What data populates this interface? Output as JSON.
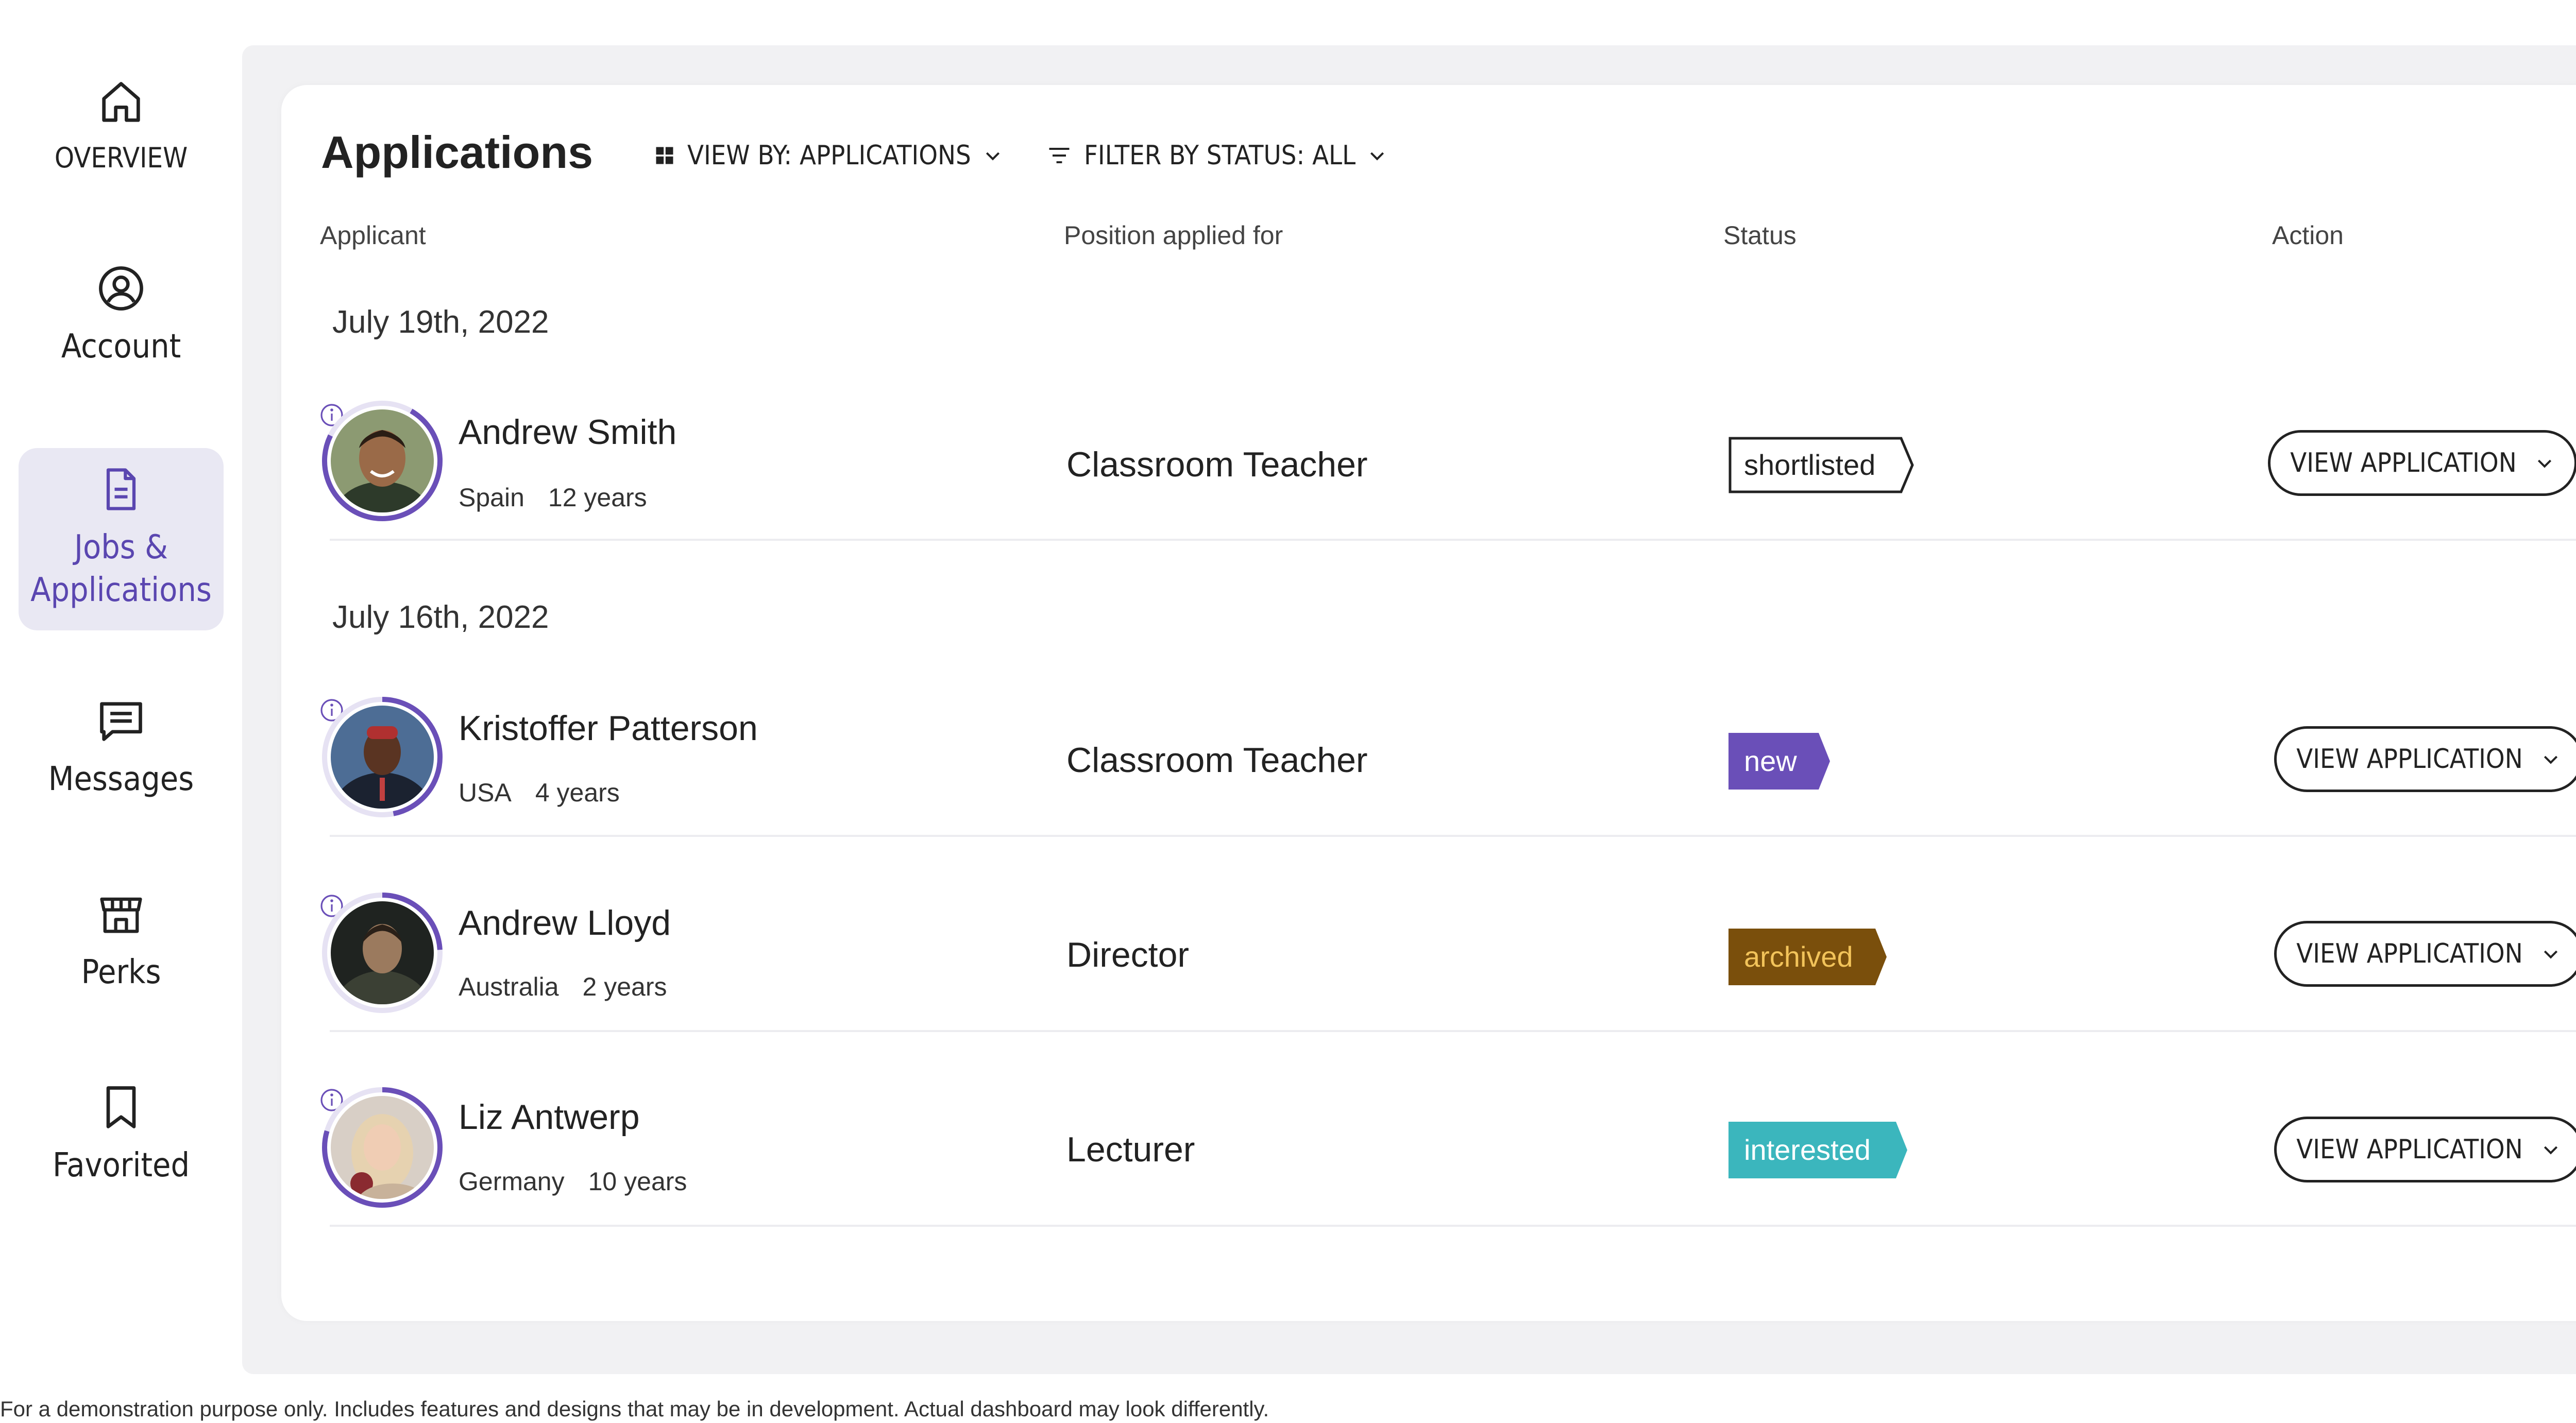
{
  "sidebar": {
    "items": [
      {
        "label": "OVERVIEW",
        "icon": "home-icon"
      },
      {
        "label": "Account",
        "icon": "user-circle-icon"
      },
      {
        "label": "Jobs &",
        "label2": "Applications",
        "icon": "document-icon",
        "active": true
      },
      {
        "label": "Messages",
        "icon": "message-icon"
      },
      {
        "label": "Perks",
        "icon": "storefront-icon"
      },
      {
        "label": "Favorited",
        "icon": "bookmark-icon"
      }
    ]
  },
  "header": {
    "title": "Applications",
    "view_by_label": "VIEW BY: APPLICATIONS",
    "filter_label": "FILTER BY STATUS: ALL"
  },
  "columns": {
    "applicant": "Applicant",
    "position": "Position applied for",
    "status": "Status",
    "action": "Action"
  },
  "groups": [
    {
      "date": "July 19th, 2022"
    },
    {
      "date": "July 16th, 2022"
    }
  ],
  "applications": [
    {
      "name": "Andrew Smith",
      "country": "Spain",
      "experience": "12 years",
      "position": "Classroom Teacher",
      "status": "shortlisted",
      "action": "VIEW APPLICATION"
    },
    {
      "name": "Kristoffer Patterson",
      "country": "USA",
      "experience": "4 years",
      "position": "Classroom Teacher",
      "status": "new",
      "action": "VIEW APPLICATION"
    },
    {
      "name": "Andrew Lloyd",
      "country": "Australia",
      "experience": "2 years",
      "position": "Director",
      "status": "archived",
      "action": "VIEW APPLICATION"
    },
    {
      "name": "Liz Antwerp",
      "country": "Germany",
      "experience": "10 years",
      "position": "Lecturer",
      "status": "interested",
      "action": "VIEW APPLICATION"
    }
  ],
  "status_colors": {
    "shortlisted": "#ffffff",
    "new": "#6a4fb8",
    "archived": "#7a4f0c",
    "interested": "#3bb6bd"
  },
  "accent_color": "#6a4fb8",
  "footer": {
    "disclaimer": "For a demonstration purpose only. Includes features and designs that may be in development. Actual dashboard may look differently."
  }
}
